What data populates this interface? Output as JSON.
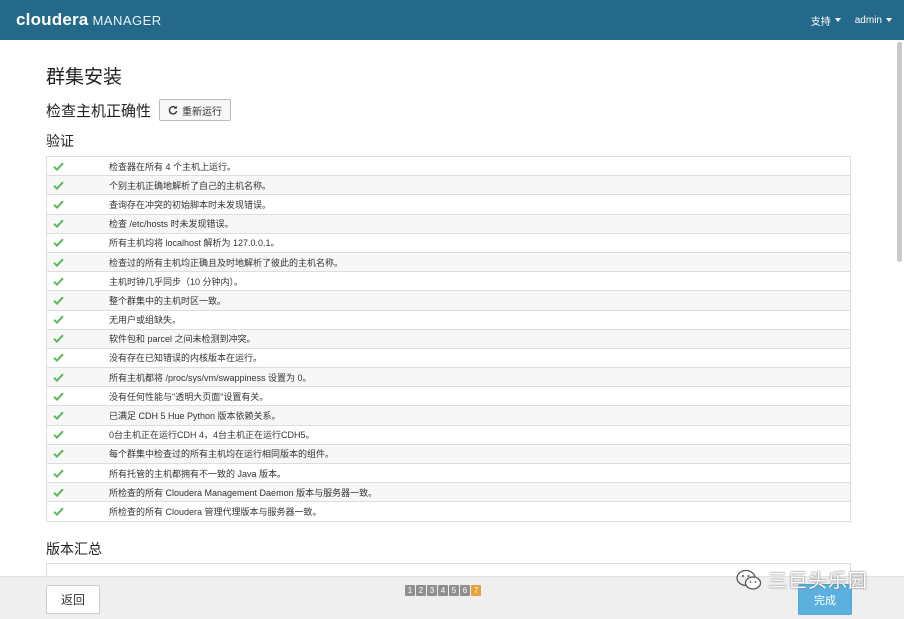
{
  "header": {
    "brand_main": "cloudera",
    "brand_sub": "MANAGER",
    "support_label": "支持",
    "user_label": "admin"
  },
  "page": {
    "title": "群集安装",
    "check_heading": "检查主机正确性",
    "rerun_label": "重新运行",
    "verify_heading": "验证",
    "summary_heading": "版本汇总"
  },
  "checks": [
    "检查器在所有 4 个主机上运行。",
    "个别主机正确地解析了自己的主机名称。",
    "查询存在冲突的初始脚本时未发现错误。",
    "检查 /etc/hosts 时未发现错误。",
    "所有主机均将 localhost 解析为 127.0.0.1。",
    "检查过的所有主机均正确且及时地解析了彼此的主机名称。",
    "主机时钟几乎同步（10 分钟内）。",
    "整个群集中的主机时区一致。",
    "无用户或组缺失。",
    "软件包和 parcel 之间未检测到冲突。",
    "没有存在已知错误的内核版本在运行。",
    "所有主机都将 /proc/sys/vm/swappiness 设置为 0。",
    "没有任何性能与\"透明大页面\"设置有关。",
    "已满足 CDH 5 Hue Python 版本依赖关系。",
    "0台主机正在运行CDH 4，4台主机正在运行CDH5。",
    "每个群集中检查过的所有主机均在运行相同版本的组件。",
    "所有托管的主机都拥有不一致的 Java 版本。",
    "所检查的所有 Cloudera Management Daemon 版本与服务器一致。",
    "所检查的所有 Cloudera 管理代理版本与服务器一致。"
  ],
  "footer": {
    "back_label": "返回",
    "finish_label": "完成",
    "steps": [
      "1",
      "2",
      "3",
      "4",
      "5",
      "6",
      "7"
    ],
    "active_step": 7
  },
  "watermark": {
    "text": "三巨头乐园",
    "icon": "wechat-icon"
  },
  "colors": {
    "topbar": "#24698a",
    "check": "#5cb85c",
    "finish": "#5bb0de",
    "active_step": "#e6a23c"
  }
}
